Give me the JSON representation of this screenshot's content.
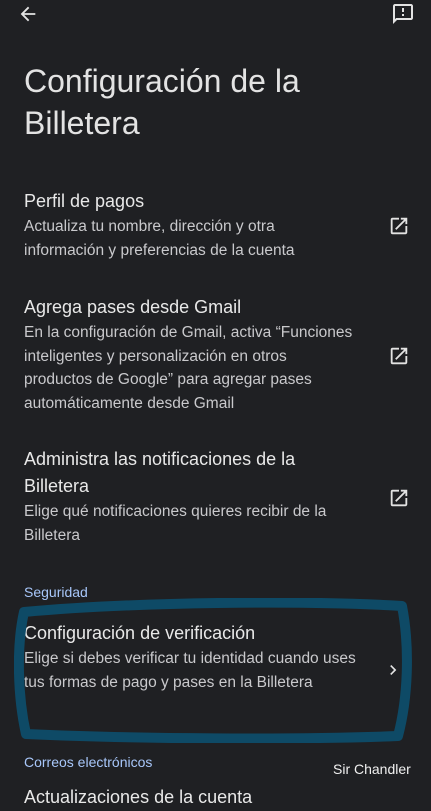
{
  "header": {
    "back_icon": "arrow-back-icon",
    "feedback_icon": "feedback-icon"
  },
  "page": {
    "title": "Configuración de la Billetera"
  },
  "items": [
    {
      "title": "Perfil de pagos",
      "description": "Actualiza tu nombre, dirección y otra información y preferencias de la cuenta",
      "trailing_icon": "open-in-new-icon"
    },
    {
      "title": "Agrega pases desde Gmail",
      "description": "En la configuración de Gmail, activa “Funciones inteligentes y personalización en otros productos de Google” para agregar pases automáticamente desde Gmail",
      "trailing_icon": "open-in-new-icon"
    },
    {
      "title": "Administra las notificaciones de la Billetera",
      "description": "Elige qué notificaciones quieres recibir de la Billetera",
      "trailing_icon": "open-in-new-icon"
    }
  ],
  "sections": {
    "seguridad": {
      "header": "Seguridad",
      "items": [
        {
          "title": "Configuración de verificación",
          "description": "Elige si debes verificar tu identidad cuando uses tus formas de pago y pases en la Billetera",
          "trailing_icon": "chevron-right-icon"
        }
      ]
    },
    "correos": {
      "header": "Correos electrónicos",
      "items": [
        {
          "title": "Actualizaciones de la cuenta"
        }
      ]
    }
  },
  "annotation": {
    "color": "#0e4a66"
  },
  "watermark": {
    "text": "Sir Chandler"
  },
  "colors": {
    "background": "#1f2023",
    "text_primary": "#e3e3e3",
    "text_secondary": "#c9c9cc",
    "accent": "#a8c7fa"
  }
}
